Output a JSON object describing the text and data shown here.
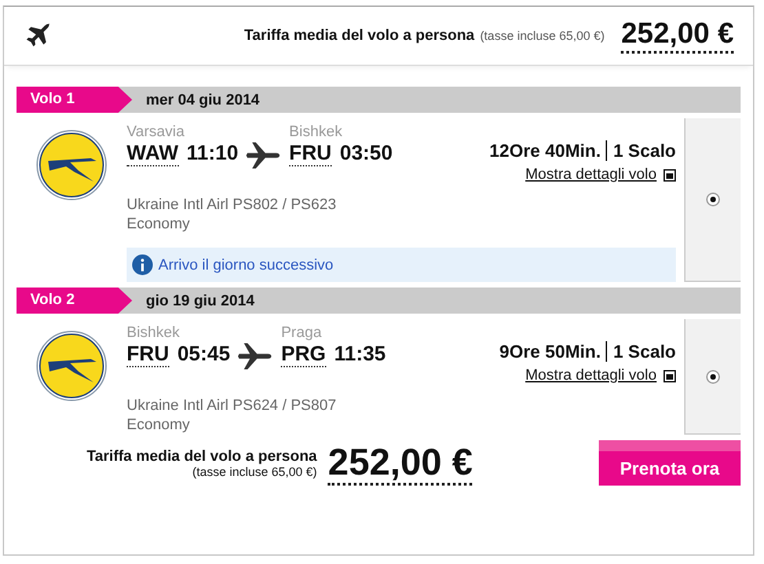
{
  "header": {
    "fare_label": "Tariffa media del volo a persona",
    "taxes": "(tasse incluse 65,00 €)",
    "price": "252,00 €"
  },
  "flights": [
    {
      "tag": "Volo 1",
      "date": "mer 04 giu 2014",
      "from_city": "Varsavia",
      "from_code": "WAW",
      "dep_time": "11:10",
      "to_city": "Bishkek",
      "to_code": "FRU",
      "arr_time": "03:50",
      "duration": "12Ore 40Min.",
      "stops": "1 Scalo",
      "details_link": "Mostra dettagli volo",
      "airline": "Ukraine Intl Airl PS802 / PS623",
      "cabin": "Economy",
      "notice": "Arrivo il giorno successivo",
      "selected": true
    },
    {
      "tag": "Volo 2",
      "date": "gio 19 giu 2014",
      "from_city": "Bishkek",
      "from_code": "FRU",
      "dep_time": "05:45",
      "to_city": "Praga",
      "to_code": "PRG",
      "arr_time": "11:35",
      "duration": "9Ore 50Min.",
      "stops": "1 Scalo",
      "details_link": "Mostra dettagli volo",
      "airline": "Ukraine Intl Airl PS624 / PS807",
      "cabin": "Economy",
      "selected": true
    }
  ],
  "footer": {
    "fare_label": "Tariffa media del volo a persona",
    "taxes": "(tasse incluse 65,00 €)",
    "price": "252,00 €",
    "book_button": "Prenota ora"
  }
}
